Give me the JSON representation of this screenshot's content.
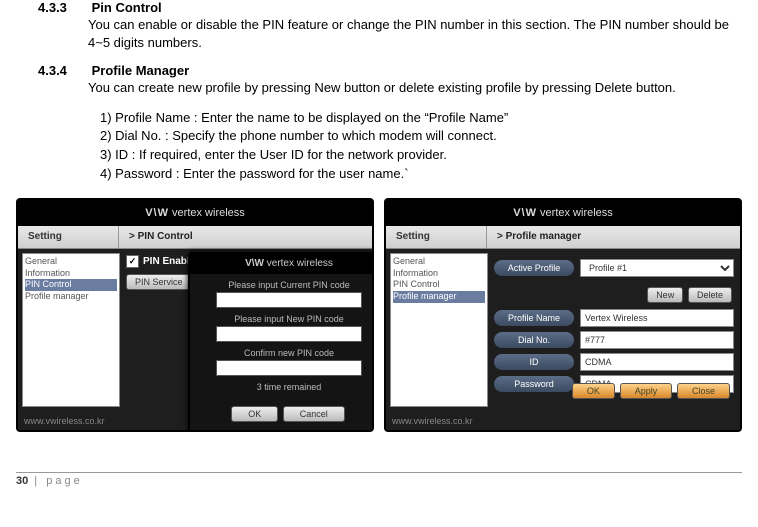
{
  "sections": {
    "pin": {
      "num": "4.3.3",
      "title": "Pin Control",
      "body": "You can enable or disable the PIN feature or change the PIN number in this section. The PIN number should be 4~5 digits numbers."
    },
    "pm": {
      "num": "4.3.4",
      "title": "Profile Manager",
      "body": "You can create new profile by pressing New button or delete existing profile by pressing Delete button.",
      "items": [
        "1) Profile Name : Enter the name to be displayed on the “Profile Name”",
        "2) Dial No. : Specify the phone number to which modem will connect.",
        "3) ID : If required, enter the User ID for the network provider.",
        "4) Password : Enter the password for the user name.`"
      ]
    }
  },
  "brand": "vertex wireless",
  "brand_glyph": "V\\W",
  "site": "www.vwireless.co.kr",
  "left": {
    "crumb1": "Setting",
    "crumb2": "> PIN Control",
    "side": [
      "General",
      "Information",
      "PIN Control",
      "Profile manager"
    ],
    "side_sel": 2,
    "pin_enable": "PIN Enable",
    "pin_service": "PIN Service",
    "ok": "OK",
    "popup": {
      "l1": "Please input Current PIN code",
      "l2": "Please input New PIN code",
      "l3": "Confirm new PIN code",
      "l4": "3 time remained",
      "ok": "OK",
      "cancel": "Cancel"
    }
  },
  "right": {
    "crumb1": "Setting",
    "crumb2": "> Profile manager",
    "side": [
      "General",
      "Information",
      "PIN Control",
      "Profile manager"
    ],
    "side_sel": 3,
    "labels": {
      "active": "Active Profile",
      "pname": "Profile Name",
      "dial": "Dial No.",
      "id": "ID",
      "pwd": "Password"
    },
    "values": {
      "active": "Profile #1",
      "pname": "Vertex Wireless",
      "dial": "#777",
      "id": "CDMA",
      "pwd": "CDMA"
    },
    "btn": {
      "new": "New",
      "del": "Delete",
      "ok": "OK",
      "apply": "Apply",
      "close": "Close"
    }
  },
  "pagefoot": {
    "num": "30",
    "sep": " | ",
    "word": "page"
  }
}
